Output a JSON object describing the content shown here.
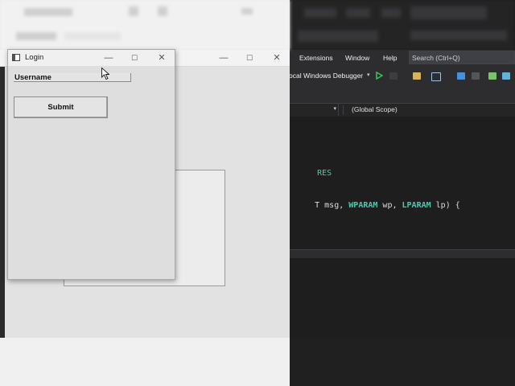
{
  "login_window": {
    "title": "Login",
    "username_value": "Username",
    "submit_label": "Submit",
    "minimize_glyph": "—",
    "maximize_glyph": "☐",
    "close_glyph": "✕"
  },
  "background_window": {
    "minimize_glyph": "—",
    "maximize_glyph": "☐",
    "close_glyph": "✕"
  },
  "visual_studio": {
    "menu": [
      "Extensions",
      "Window",
      "Help"
    ],
    "search_placeholder": "Search (Ctrl+Q)",
    "debugger_label": "ocal Windows Debugger",
    "scope_label": "(Global Scope)",
    "code": {
      "line1_macro": "RES",
      "line2_plain_a": "T msg, ",
      "line2_kw_a": "WPARAM",
      "line2_plain_b": " wp, ",
      "line2_kw_b": "LPARAM",
      "line2_plain_c": " lp) {"
    }
  },
  "colors": {
    "vs_background": "#1e1e1e",
    "vs_macro": "#4ec9b0",
    "win_background": "#dedede"
  },
  "icons": [
    "app-window-icon",
    "play-icon",
    "cursor-arrow-icon"
  ]
}
